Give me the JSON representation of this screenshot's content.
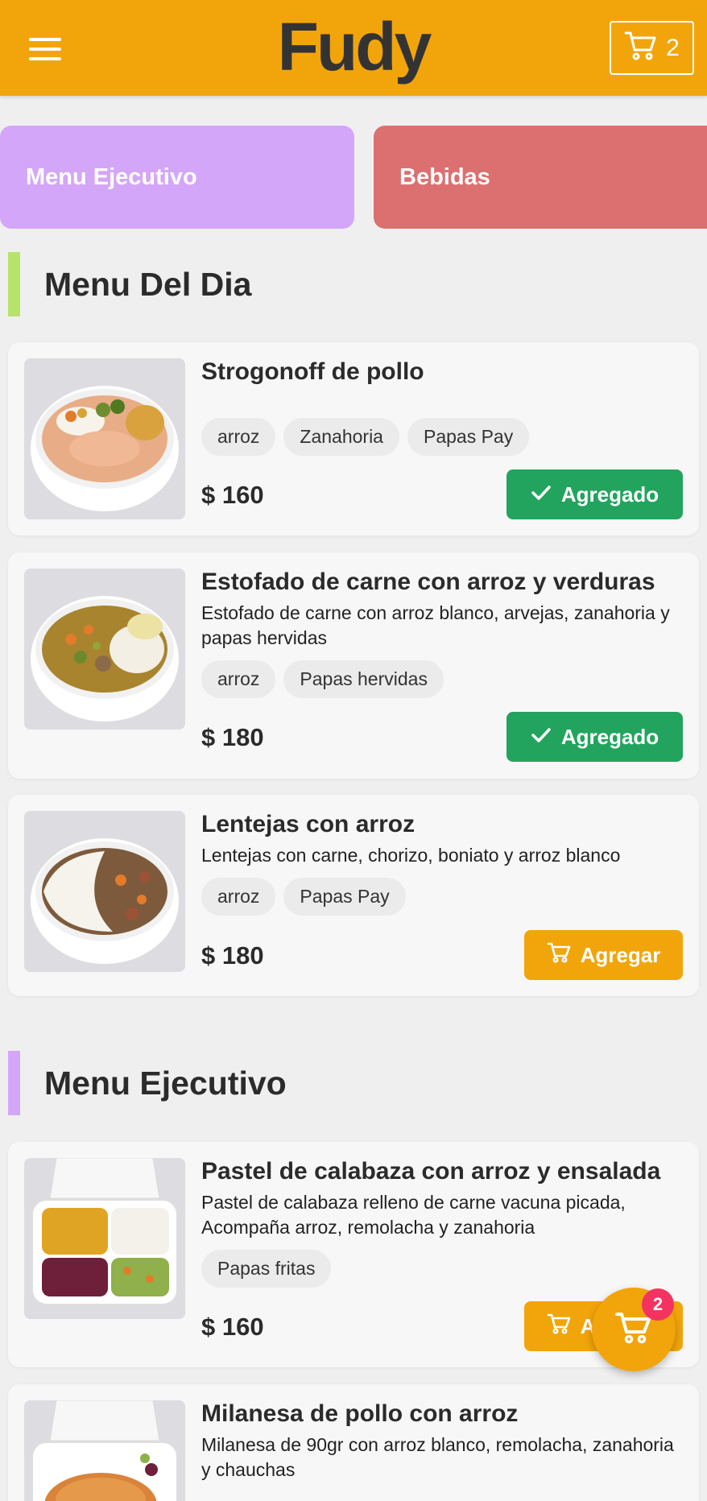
{
  "header": {
    "logo": "Fudy",
    "cart_count": "2",
    "menu_icon": "hamburger-icon",
    "cart_icon": "cart-icon",
    "brand_color": "#f2a50a"
  },
  "categories": [
    {
      "label": "Menu Ejecutivo",
      "color": "#d4a6f9"
    },
    {
      "label": "Bebidas",
      "color": "#dc7070"
    }
  ],
  "sections": [
    {
      "title": "Menu Del Dia",
      "accent": "#b6e46a",
      "items": [
        {
          "name": "Strogonoff de pollo",
          "description": "",
          "tags": [
            "arroz",
            "Zanahoria",
            "Papas Pay"
          ],
          "price": "$ 160",
          "button": "Agregado",
          "added": true
        },
        {
          "name": "Estofado de carne con arroz y verduras",
          "description": "Estofado de carne con arroz blanco, arvejas, zanahoria y papas hervidas",
          "tags": [
            "arroz",
            "Papas hervidas"
          ],
          "price": "$ 180",
          "button": "Agregado",
          "added": true
        },
        {
          "name": "Lentejas con arroz",
          "description": "Lentejas con carne, chorizo, boniato y arroz blanco",
          "tags": [
            "arroz",
            "Papas Pay"
          ],
          "price": "$ 180",
          "button": "Agregar",
          "added": false
        }
      ]
    },
    {
      "title": "Menu Ejecutivo",
      "accent": "#d4a6f9",
      "items": [
        {
          "name": "Pastel de calabaza con arroz y ensalada",
          "description": "Pastel de calabaza relleno de carne vacuna picada, Acompaña arroz, remolacha y zanahoria",
          "tags": [
            "Papas fritas"
          ],
          "price": "$ 160",
          "button": "Agregar",
          "added": false
        },
        {
          "name": "Milanesa de pollo con arroz",
          "description": "Milanesa de 90gr con arroz blanco, remolacha, zanahoria y chauchas",
          "tags": [],
          "price": "",
          "button": "",
          "added": false
        }
      ]
    }
  ],
  "floating_cart": {
    "count": "2",
    "icon": "cart-icon"
  },
  "colors": {
    "added": "#22a45e",
    "add": "#f2a50a",
    "badge": "#f43360"
  }
}
